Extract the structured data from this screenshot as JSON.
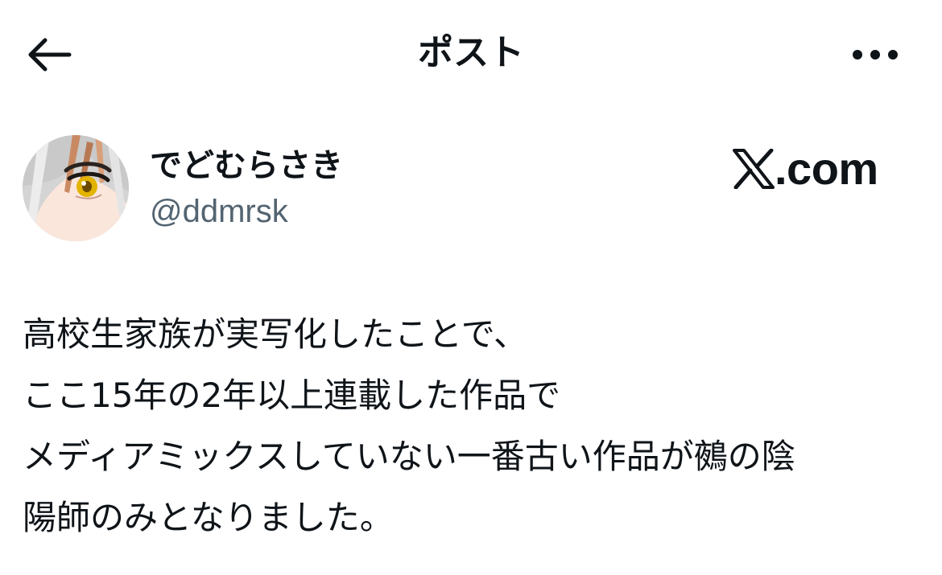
{
  "header": {
    "title": "ポスト",
    "back_icon": "arrow-left-icon",
    "more_icon": "more-horizontal-icon"
  },
  "author": {
    "display_name": "でどむらさき",
    "handle": "@ddmrsk",
    "avatar_icon": "anime-character-avatar"
  },
  "brand": {
    "text": ".com",
    "logo_icon": "x-logo-icon"
  },
  "post": {
    "lines": [
      "高校生家族が実写化したことで、",
      "ここ15年の2年以上連載した作品で",
      "メディアミックスしていない一番古い作品が鵺の陰",
      "陽師のみとなりました。"
    ]
  },
  "colors": {
    "text_primary": "#0f1419",
    "text_secondary": "#536471",
    "background": "#ffffff"
  }
}
